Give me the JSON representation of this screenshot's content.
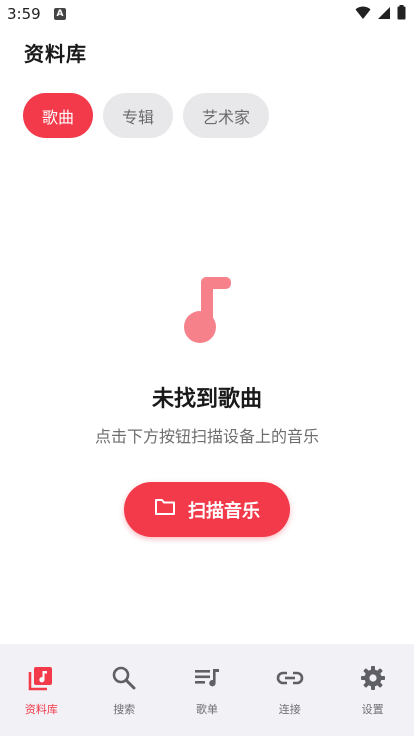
{
  "status_bar": {
    "time": "3:59",
    "app_icon_letter": "A"
  },
  "header": {
    "title": "资料库"
  },
  "tabs": [
    {
      "label": "歌曲",
      "active": true
    },
    {
      "label": "专辑",
      "active": false
    },
    {
      "label": "艺术家",
      "active": false
    }
  ],
  "empty_state": {
    "icon": "music-note-icon",
    "title": "未找到歌曲",
    "subtitle": "点击下方按钮扫描设备上的音乐",
    "button_label": "扫描音乐",
    "button_icon": "folder-icon"
  },
  "bottom_nav": [
    {
      "label": "资料库",
      "icon": "library-icon",
      "active": true
    },
    {
      "label": "搜索",
      "icon": "search-icon",
      "active": false
    },
    {
      "label": "歌单",
      "icon": "playlist-icon",
      "active": false
    },
    {
      "label": "连接",
      "icon": "link-icon",
      "active": false
    },
    {
      "label": "设置",
      "icon": "gear-icon",
      "active": false
    }
  ],
  "colors": {
    "accent": "#f23a4a",
    "accent_light": "#f7818b",
    "chip_inactive": "#e8e8eb",
    "nav_background": "#f2f2f6",
    "nav_icon": "#5f5f66"
  }
}
